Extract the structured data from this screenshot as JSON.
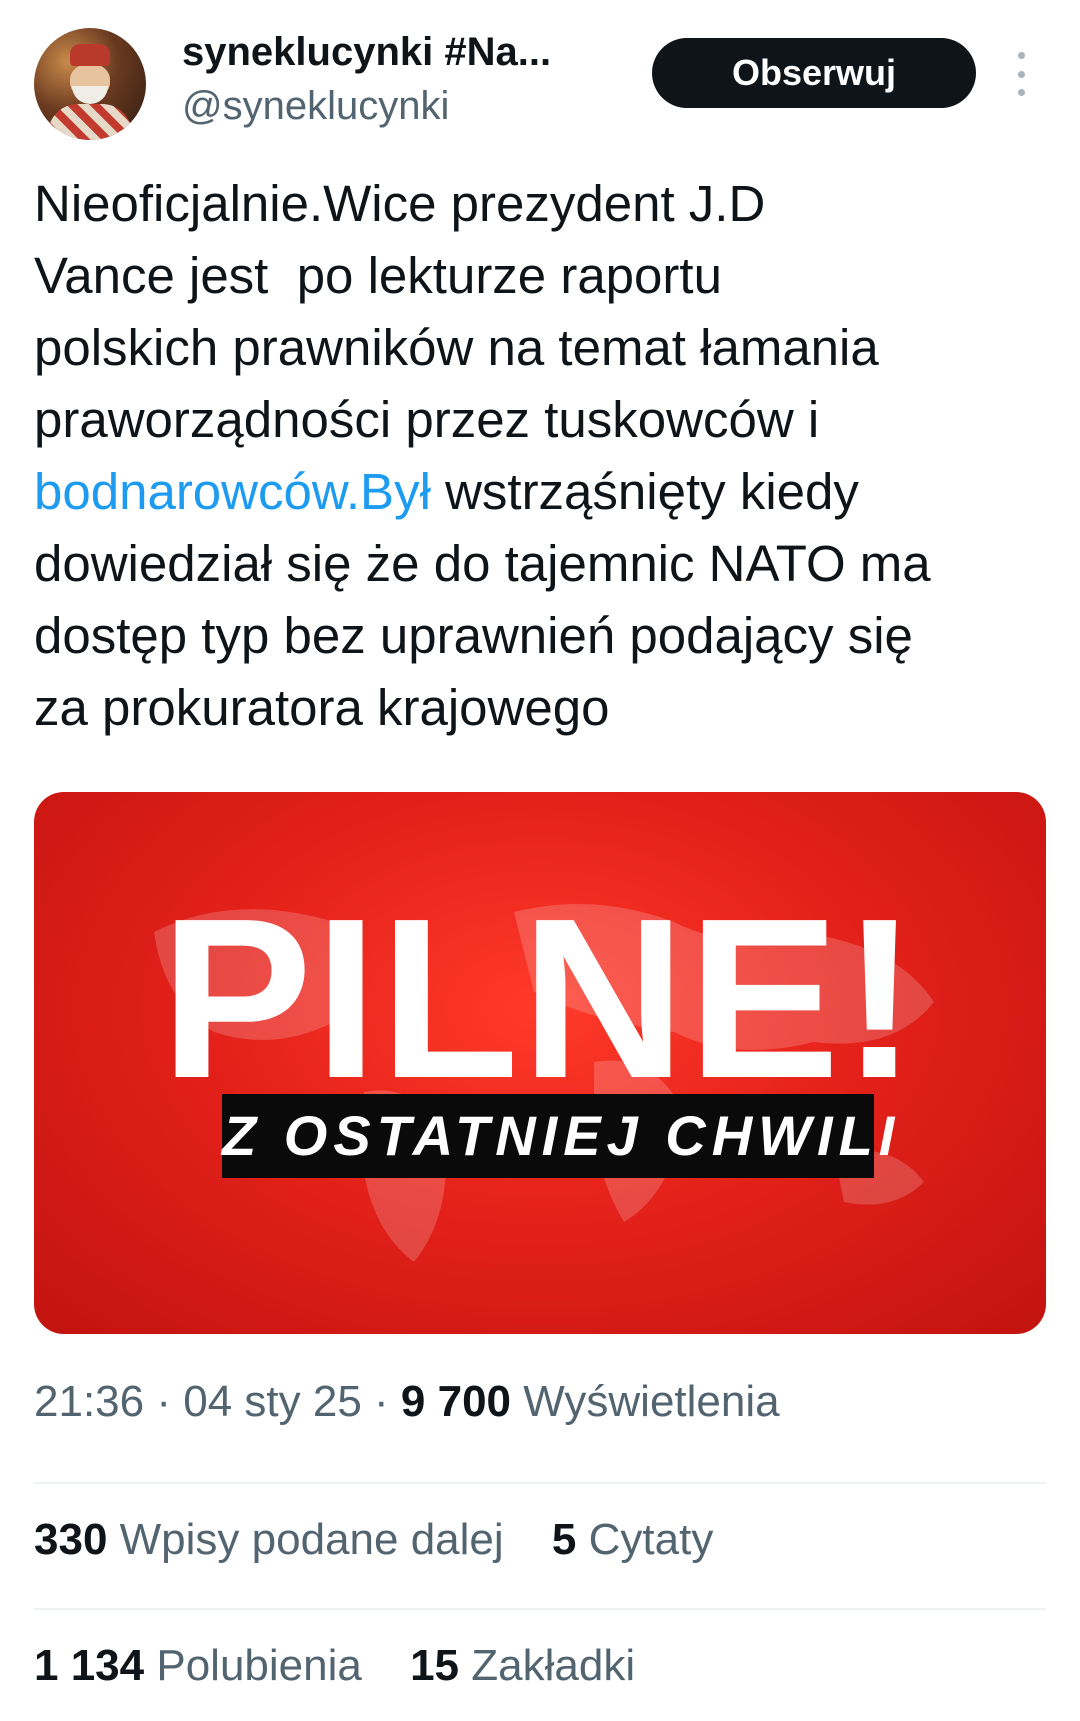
{
  "author": {
    "display_name": "syneklucynki #Na...",
    "handle": "@syneklucynki",
    "follow_label": "Obserwuj"
  },
  "tweet": {
    "text_before_link": "Nieoficjalnie.Wice prezydent J.D\nVance jest  po lekturze raportu\npolskich prawników na temat łamania\npraworządności przez tuskowców i\n",
    "link_text": "bodnarowców.Był",
    "text_after_link": " wstrząśnięty kiedy\ndowiedział się że do tajemnic NATO ma\ndostęp typ bez uprawnień podający się\nza prokuratora krajowego"
  },
  "media": {
    "headline": "PILNE!",
    "banner": "Z OSTATNIEJ CHWILI",
    "colors": {
      "background": "#e4211a",
      "headline": "#ffffff",
      "banner_bg": "#0a0a0a"
    }
  },
  "meta": {
    "time": "21:36",
    "separator": "·",
    "date": "04 sty 25",
    "views_count": "9 700",
    "views_label": "Wyświetlenia"
  },
  "stats": {
    "reposts_count": "330",
    "reposts_label": "Wpisy podane dalej",
    "quotes_count": "5",
    "quotes_label": "Cytaty",
    "likes_count": "1 134",
    "likes_label": "Polubienia",
    "bookmarks_count": "15",
    "bookmarks_label": "Zakładki"
  },
  "colors": {
    "text": "#0f1419",
    "secondary": "#536471",
    "link": "#1d9bf0",
    "divider": "#eff3f4"
  }
}
